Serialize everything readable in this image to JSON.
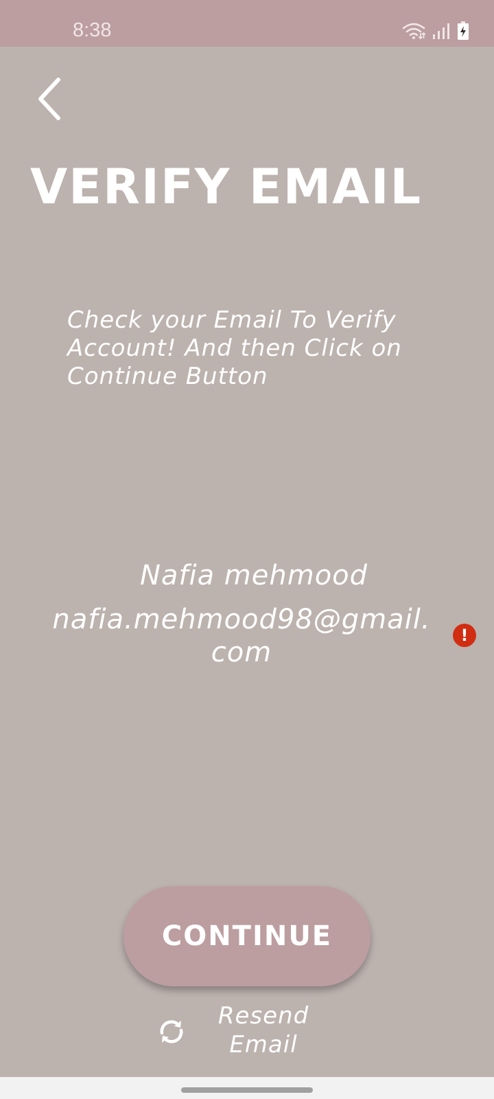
{
  "status_bar": {
    "time": "8:38",
    "icons": [
      "wifi-icon",
      "signal-icon",
      "battery-charging-icon"
    ],
    "background": "#bc9ea0"
  },
  "header": {
    "back_icon": "chevron-left-icon",
    "title": "VERIFY EMAIL"
  },
  "main": {
    "instructions": "Check your Email To Verify Account!  And then Click on Continue Button",
    "user_name": "Nafia mehmood",
    "user_email": "nafia.mehmood98@gmail.com",
    "error_icon": "alert-icon",
    "error_symbol": "!",
    "error_color": "#d12d12"
  },
  "actions": {
    "continue_label": "CONTINUE",
    "resend_icon": "refresh-icon",
    "resend_label": "Resend Email"
  },
  "colors": {
    "background": "#bcb2ae",
    "accent": "#bc9ea0",
    "text": "#ffffff"
  }
}
